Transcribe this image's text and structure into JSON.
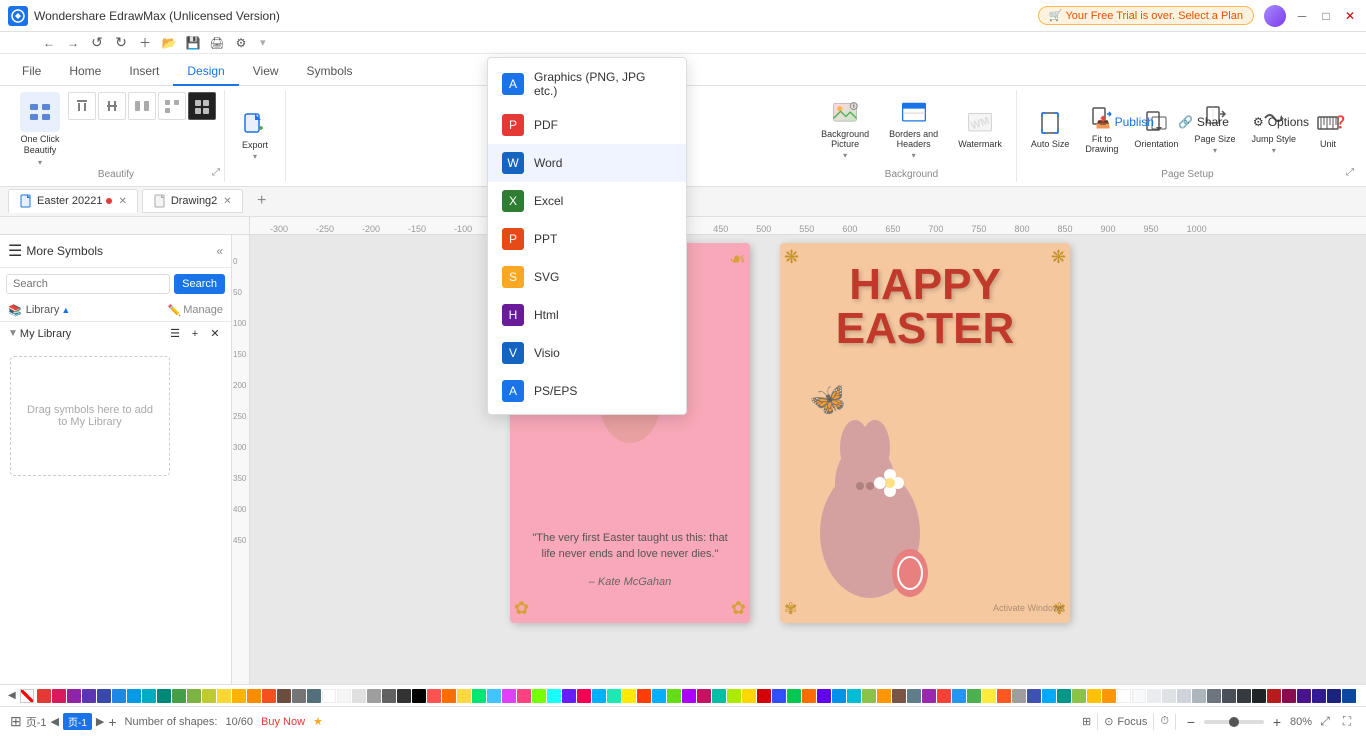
{
  "app": {
    "title": "Wondershare EdrawMax (Unlicensed Version)",
    "trial_banner": "🛒 Your Free Trial is over. Select a Plan"
  },
  "quick_access": {
    "buttons": [
      "←",
      "→",
      "↺",
      "↻",
      "＋",
      "📁",
      "💾",
      "🖨",
      "⚙"
    ]
  },
  "ribbon": {
    "tabs": [
      {
        "label": "File",
        "active": false
      },
      {
        "label": "Home",
        "active": false
      },
      {
        "label": "Insert",
        "active": false
      },
      {
        "label": "Design",
        "active": true
      },
      {
        "label": "View",
        "active": false
      },
      {
        "label": "Symbols",
        "active": false
      }
    ],
    "actions": [
      {
        "label": "Publish",
        "icon": "publish-icon"
      },
      {
        "label": "Share",
        "icon": "share-icon"
      },
      {
        "label": "Options",
        "icon": "options-icon"
      }
    ],
    "beautify_group": {
      "label": "Beautify",
      "one_click_label": "One Click Beautify",
      "buttons": [
        "↕",
        "↔",
        "⇑",
        "⇓",
        "↻",
        "■"
      ]
    },
    "background_group": {
      "label": "Background",
      "items": [
        {
          "label": "Background Picture",
          "icon": "bg-picture-icon"
        },
        {
          "label": "Borders and Headers",
          "icon": "borders-icon"
        },
        {
          "label": "Watermark",
          "icon": "watermark-icon"
        }
      ]
    },
    "page_setup_group": {
      "label": "Page Setup",
      "items": [
        {
          "label": "Auto Size",
          "icon": "auto-size-icon"
        },
        {
          "label": "Fit to Drawing",
          "icon": "fit-drawing-icon"
        },
        {
          "label": "Orientation",
          "icon": "orientation-icon"
        },
        {
          "label": "Page Size",
          "icon": "page-size-icon"
        },
        {
          "label": "Jump Style",
          "icon": "jump-style-icon"
        },
        {
          "label": "Unit",
          "icon": "unit-icon"
        }
      ]
    }
  },
  "sidebar": {
    "header": "More Symbols",
    "search_placeholder": "Search",
    "search_btn": "Search",
    "library_label": "Library",
    "manage_label": "Manage",
    "my_library_label": "My Library",
    "drop_text": "Drag symbols here to add to My Library"
  },
  "docs": {
    "tabs": [
      {
        "label": "Easter 20221",
        "active": true,
        "dot": true
      },
      {
        "label": "Drawing2",
        "active": false,
        "dot": false
      }
    ]
  },
  "export_menu": {
    "items": [
      {
        "label": "Graphics (PNG, JPG etc.)",
        "icon_color": "#1a73e8",
        "icon_text": "A"
      },
      {
        "label": "PDF",
        "icon_color": "#e53935",
        "icon_text": "P"
      },
      {
        "label": "Word",
        "icon_color": "#1565c0",
        "icon_text": "W"
      },
      {
        "label": "Excel",
        "icon_color": "#2e7d32",
        "icon_text": "X"
      },
      {
        "label": "PPT",
        "icon_color": "#e64a19",
        "icon_text": "P"
      },
      {
        "label": "SVG",
        "icon_color": "#f9a825",
        "icon_text": "S"
      },
      {
        "label": "Html",
        "icon_color": "#6a1b9a",
        "icon_text": "H"
      },
      {
        "label": "Visio",
        "icon_color": "#1565c0",
        "icon_text": "V"
      },
      {
        "label": "PS/EPS",
        "icon_color": "#1a73e8",
        "icon_text": "A"
      }
    ]
  },
  "canvas": {
    "quote": "\"The very first Easter taught us this: that life never ends and love never dies.\"",
    "attribution": "– Kate McGahan",
    "happy_easter": "HAPPY EASTER"
  },
  "status": {
    "shapes_label": "Number of shapes:",
    "shapes_value": "10/60",
    "buy_now": "Buy Now",
    "focus_label": "Focus",
    "zoom_level": "80%",
    "page": "页-1"
  },
  "colors": [
    "#e53935",
    "#d81b60",
    "#8e24aa",
    "#5e35b1",
    "#3949ab",
    "#1e88e5",
    "#039be5",
    "#00acc1",
    "#00897b",
    "#43a047",
    "#7cb342",
    "#c0ca33",
    "#fdd835",
    "#ffb300",
    "#fb8c00",
    "#f4511e",
    "#6d4c41",
    "#757575",
    "#546e7a",
    "#fff",
    "#f5f5f5",
    "#e0e0e0",
    "#9e9e9e",
    "#616161",
    "#333",
    "#000",
    "#ff5252",
    "#ff6d00",
    "#ffd740",
    "#00e676",
    "#40c4ff",
    "#e040fb",
    "#ff4081",
    "#76ff03",
    "#18ffff",
    "#651fff",
    "#f50057",
    "#00b0ff",
    "#1de9b6",
    "#ffea00",
    "#ff3d00",
    "#00b0ff",
    "#64dd17",
    "#aa00ff",
    "#c51162",
    "#00bfa5",
    "#aeea00",
    "#ffd600",
    "#d50000",
    "#304ffe",
    "#00c853",
    "#ff6d00",
    "#6200ea",
    "#0091ea",
    "#00bcd4",
    "#8bc34a",
    "#ff9800",
    "#795548",
    "#607d8b",
    "#9c27b0",
    "#f44336",
    "#2196f3",
    "#4caf50",
    "#ffeb3b",
    "#ff5722",
    "#9e9e9e",
    "#3f51b5",
    "#03a9f4",
    "#009688",
    "#8bc34a",
    "#ffc107",
    "#ff9800",
    "#ffffff",
    "#f8f9fa",
    "#e9ecef",
    "#dee2e6",
    "#ced4da",
    "#adb5bd",
    "#6c757d",
    "#495057",
    "#343a40",
    "#212529",
    "#b71c1c",
    "#880e4f",
    "#4a148c",
    "#311b92",
    "#1a237e",
    "#0d47a1"
  ]
}
